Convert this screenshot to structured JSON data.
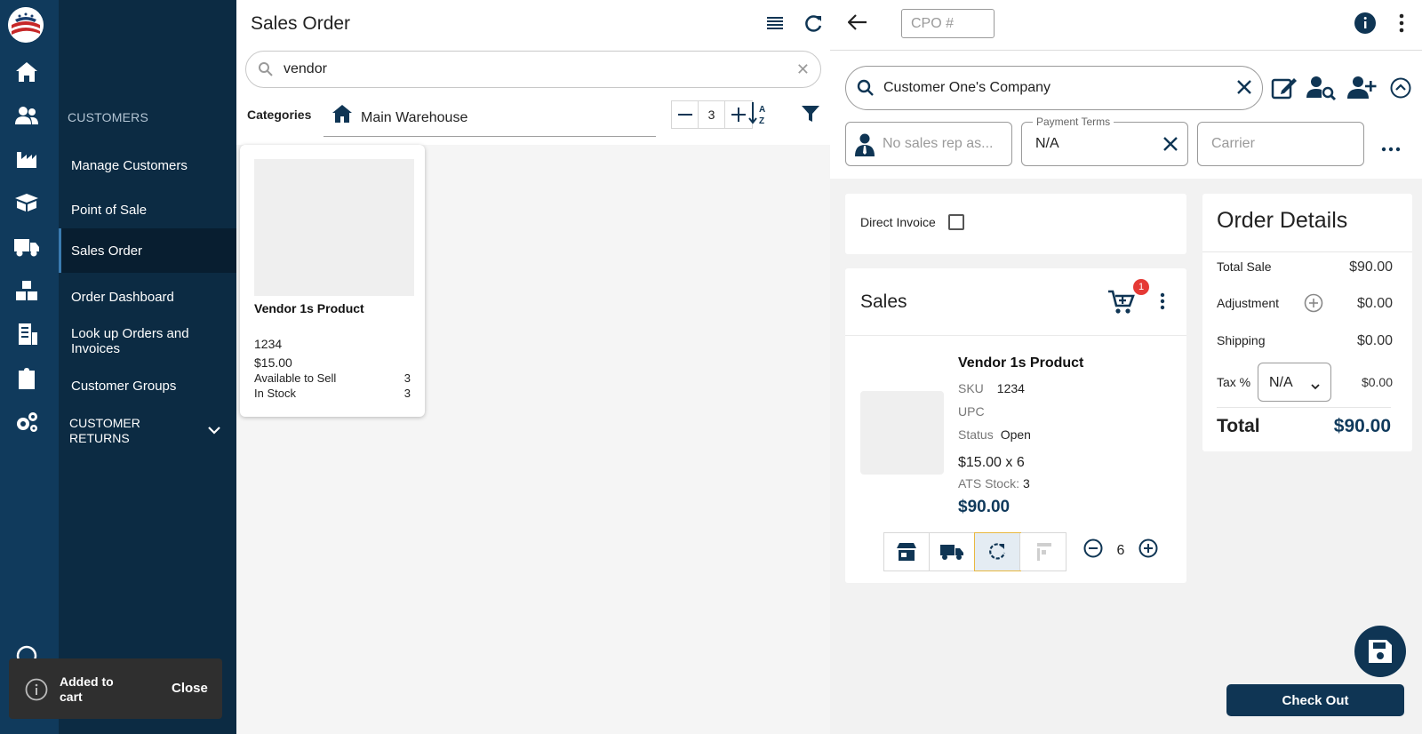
{
  "sidebar": {
    "section": "CUSTOMERS",
    "items": [
      {
        "label": "Manage Customers"
      },
      {
        "label": "Point of Sale"
      },
      {
        "label": "Sales Order"
      },
      {
        "label": "Order Dashboard"
      },
      {
        "label": "Look up Orders and Invoices"
      },
      {
        "label": "Customer Groups"
      }
    ],
    "returns_label": "CUSTOMER RETURNS"
  },
  "toast": {
    "message": "Added to cart",
    "close_label": "Close"
  },
  "catalog": {
    "title": "Sales Order",
    "search_value": "vendor",
    "categories_label": "Categories",
    "warehouse": "Main Warehouse",
    "columns": "3",
    "product": {
      "name": "Vendor 1s Product",
      "sku": "1234",
      "price": "$15.00",
      "available_label": "Available to Sell",
      "available": "3",
      "instock_label": "In Stock",
      "instock": "3"
    }
  },
  "order": {
    "cpo_placeholder": "CPO #",
    "customer": "Customer One's Company",
    "sales_rep_placeholder": "No sales rep as...",
    "payment_terms_label": "Payment Terms",
    "payment_terms": "N/A",
    "carrier_placeholder": "Carrier",
    "direct_invoice_label": "Direct Invoice",
    "sales_title": "Sales",
    "cart_count": "1",
    "line": {
      "name": "Vendor 1s Product",
      "sku_label": "SKU",
      "sku": "1234",
      "upc_label": "UPC",
      "upc": "",
      "status_label": "Status",
      "status": "Open",
      "price_qty": "$15.00  x 6",
      "ats_label": "ATS Stock:",
      "ats": "3",
      "total": "$90.00",
      "quantity": "6"
    },
    "details": {
      "title": "Order Details",
      "total_sale_label": "Total Sale",
      "total_sale": "$90.00",
      "adjustment_label": "Adjustment",
      "adjustment": "$0.00",
      "shipping_label": "Shipping",
      "shipping": "$0.00",
      "tax_label": "Tax %",
      "tax_select": "N/A",
      "tax": "$0.00",
      "total_label": "Total",
      "total": "$90.00"
    },
    "checkout_label": "Check Out"
  },
  "colors": {
    "brand_navy": "#0f3554",
    "sidebar": "#0c2b43",
    "rail": "#103a5c",
    "badge": "#e53935"
  }
}
